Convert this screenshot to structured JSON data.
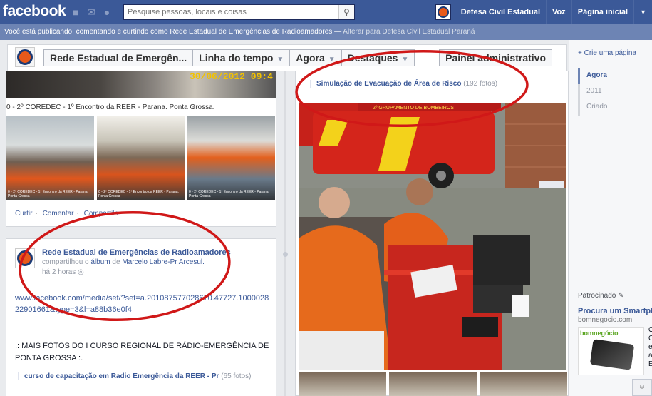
{
  "topbar": {
    "logo": "facebook",
    "search_placeholder": "Pesquise pessoas, locais e coisas",
    "page_name": "Defesa Civil Estadual",
    "voz": "Voz",
    "home": "Página inicial"
  },
  "banner": {
    "text": "Você está publicando, comentando e curtindo como Rede Estadual de Emergências de Radioamadores — ",
    "switch": "Alterar para Defesa Civil Estadual Paraná"
  },
  "timeline_header": {
    "page_button": "Rede Estadual de Emergên...",
    "timeline": "Linha do tempo",
    "now": "Agora",
    "highlights": "Destaques",
    "admin_panel": "Painel administrativo"
  },
  "story1": {
    "timestamp": "30/06/2012 09:4",
    "caption": "0 - 2º COREDEC - 1º Encontro da REER - Parana. Ponta Grossa.",
    "thumbs": [
      "0 - 2º COREDEC - 1º Encontro da REER - Parana. Ponta Grossa",
      "0 - 2º COREDEC - 1º Encontro da REER - Parana. Ponta Grossa",
      "0 - 2º COREDEC - 1º Encontro da REER - Parana. Ponta Grossa"
    ],
    "like": "Curtir",
    "comment": "Comentar",
    "share": "Compartilh"
  },
  "story2": {
    "author": "Rede Estadual de Emergências de Radioamadores",
    "shared_prefix": "compartilhou o ",
    "album_link": "álbum",
    "shared_of": " de ",
    "owner": "Marcelo Labre-Pr Arcesul.",
    "time": "há 2 horas",
    "url": "www.facebook.com/media/set/?set=a.201087577028670.47727.100002822901661&type=3&l=a88b36e0f4",
    "body": ".: MAIS FOTOS DO I CURSO REGIONAL DE RÁDIO-EMERGÊNCIA DE PONTA GROSSA :.",
    "album_title": "curso de capacitação em Radio Emergência da REER - Pr",
    "album_count": "(65 fotos)"
  },
  "story3": {
    "album_title": "Simulação de Evacuação de Área de Risco",
    "album_count": "(192 fotos)",
    "truck_text": "2º GRUPAMENTO DE BOMBEIROS"
  },
  "sidebar": {
    "create_page": "+ Crie uma página",
    "years": [
      "Agora",
      "2011",
      "Criado"
    ],
    "sponsored": "Patrocinado",
    "ad_title": "Procura um Smartph",
    "ad_url": "bomnegocio.com",
    "ad_logo": "bomnegócio",
    "ad_text_lines": [
      "O",
      "C",
      "e",
      "a",
      "E"
    ]
  },
  "colors": {
    "brand_blue": "#3b5998",
    "banner_blue": "#6d84b4",
    "annotation_red": "#d01818"
  }
}
